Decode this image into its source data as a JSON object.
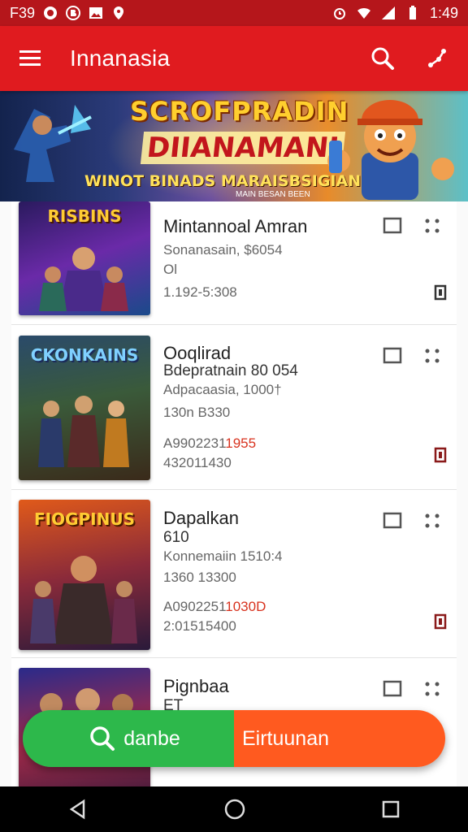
{
  "status_bar": {
    "left_text": "F39",
    "time": "1:49",
    "icons": [
      "app-icon-o",
      "app-icon-b",
      "image-icon",
      "location-icon",
      "alarm-icon",
      "wifi-icon",
      "signal-icon",
      "battery-icon"
    ]
  },
  "app_bar": {
    "title": "Innanasia",
    "icons": [
      "menu-icon",
      "search-icon",
      "share-icon"
    ]
  },
  "banner": {
    "line1": "SCROFPRADIN",
    "line2": "DIIANAMANI",
    "line3": "WINOT BINADS MARAISBSIGIAN",
    "line4": "MAIN BESAN BEEN"
  },
  "items": [
    {
      "thumb_title": "RISBINS",
      "title": "Mintannoal Amran",
      "line1": "Sonanasain, $6054",
      "line2": "Ol",
      "line3": "1.192-5:308",
      "line4_dark": "",
      "line4_red": "",
      "line5": ""
    },
    {
      "thumb_title": "CKONKAINS",
      "title": "Ooqlirad",
      "line1": "Bdepratnain 80 054",
      "line2": "Adpacaasia, 1000†",
      "line3": "130n B330",
      "line4_dark": "A9902231",
      "line4_red": "1955",
      "line5": "432011430"
    },
    {
      "thumb_title": "FIOGPINUS",
      "title": "Dapalkan",
      "line1": "610",
      "line2": "Konnemaiin 1510:4",
      "line3": "1360 13300",
      "line4_dark": "A0902251",
      "line4_red": "1030D",
      "line5": "2:01515400"
    },
    {
      "thumb_title": "",
      "title": "Pignbaa",
      "line1": "ET",
      "line2": "",
      "line3": "",
      "line4_dark": "",
      "line4_red": "",
      "line5": ""
    }
  ],
  "fab": {
    "left_label": "danbe",
    "right_label": "Eirtuunan"
  },
  "colors": {
    "app_bar": "#e01b1f",
    "status_bar": "#b5161b",
    "fab_green": "#2db84b",
    "fab_orange": "#ff5a1f",
    "accent_red": "#d8321e"
  }
}
